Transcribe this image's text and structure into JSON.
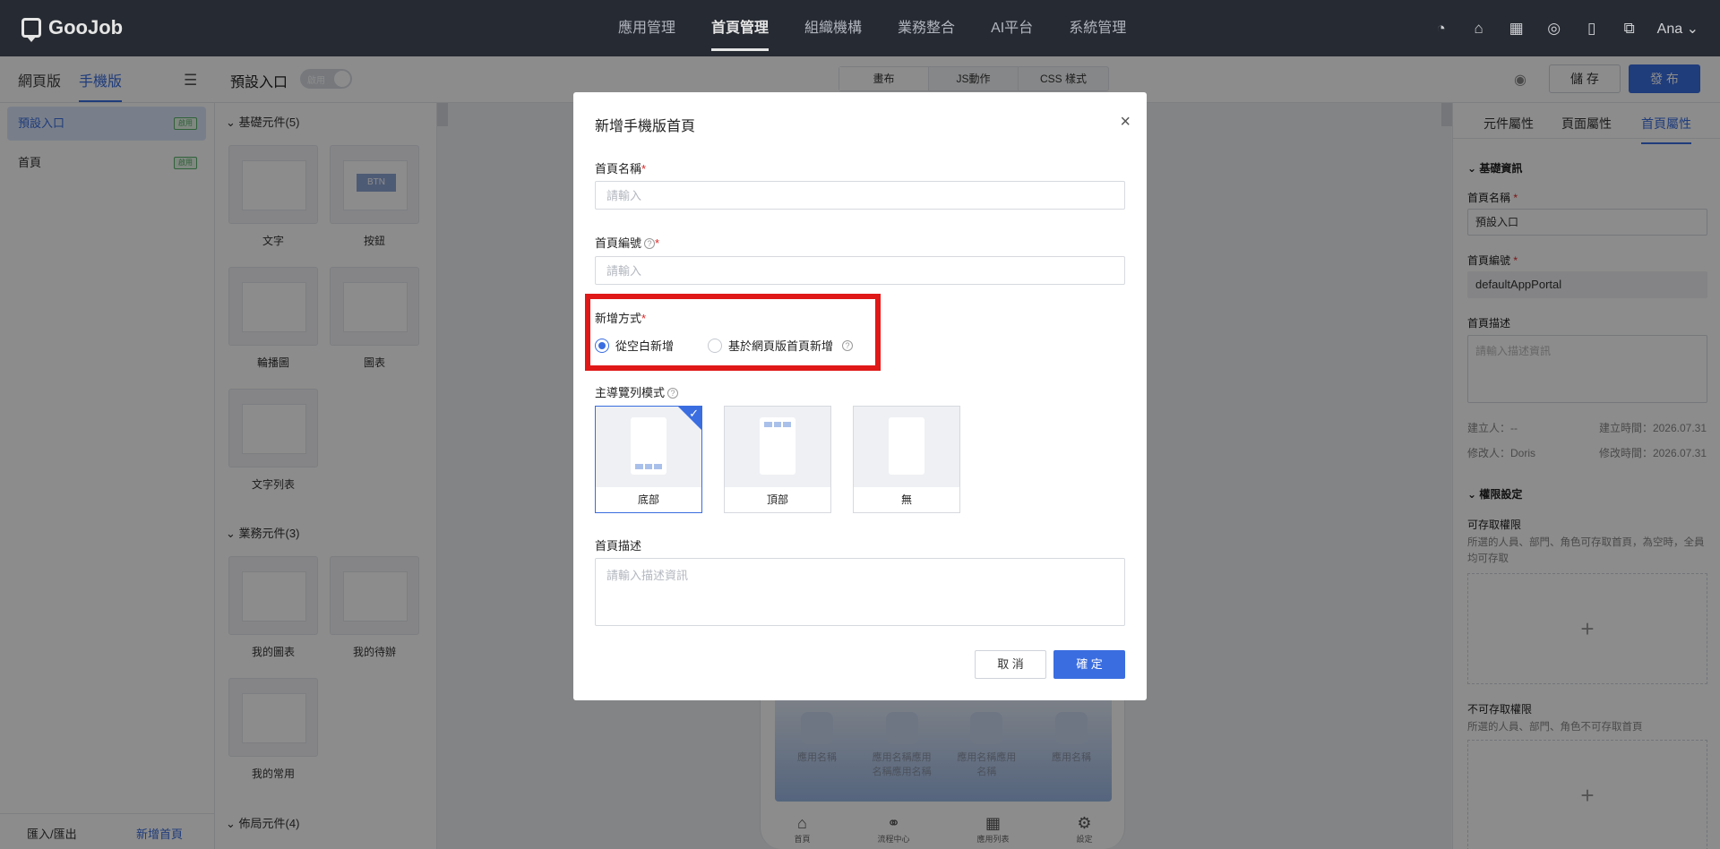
{
  "header": {
    "logo": "GooJob",
    "nav": [
      "應用管理",
      "首頁管理",
      "組織機構",
      "業務整合",
      "AI平台",
      "系統管理"
    ],
    "user": "Ana"
  },
  "toolbar": {
    "tab_web": "網頁版",
    "tab_mobile": "手機版",
    "entry_title": "預設入口",
    "toggle_label": "啟用",
    "segments": [
      "畫布",
      "JS動作",
      "CSS 樣式"
    ],
    "save_label": "儲 存",
    "publish_label": "發 布"
  },
  "sidebar": {
    "items": [
      {
        "label": "預設入口",
        "badge": "啟用"
      },
      {
        "label": "首頁",
        "badge": "啟用"
      }
    ],
    "import_export": "匯入/匯出",
    "add_home": "新增首頁"
  },
  "components": {
    "basic_title": "基礎元件(5)",
    "basic": [
      "文字",
      "按鈕",
      "輪播圖",
      "圖表",
      "文字列表"
    ],
    "business_title": "業務元件(3)",
    "business": [
      "我的圖表",
      "我的待辦",
      "我的常用"
    ],
    "layout_title": "佈局元件(4)",
    "btn_thumb": "BTN"
  },
  "phone": {
    "apps": [
      "應用名稱",
      "應用名稱應用名稱應用名稱",
      "應用名稱應用名稱",
      "應用名稱"
    ],
    "tabs": [
      "首頁",
      "流程中心",
      "應用列表",
      "設定"
    ]
  },
  "right_panel": {
    "tabs": [
      "元件屬性",
      "頁面屬性",
      "首頁屬性"
    ],
    "basic_info": "基礎資訊",
    "name_label": "首頁名稱",
    "name_value": "預設入口",
    "code_label": "首頁編號",
    "code_value": "defaultAppPortal",
    "desc_label": "首頁描述",
    "desc_placeholder": "請輸入描述資訊",
    "creator": "建立人：--",
    "created_time": "建立時間：2026.07.31",
    "modifier": "修改人：Doris",
    "modified_time": "修改時間：2026.07.31",
    "perm_title": "權限設定",
    "access_label": "可存取權限",
    "access_hint": "所選的人員、部門、角色可存取首頁，為空時，全員均可存取",
    "deny_label": "不可存取權限",
    "deny_hint": "所選的人員、部門、角色不可存取首頁",
    "plus": "+"
  },
  "modal": {
    "title": "新增手機版首頁",
    "name_label": "首頁名稱",
    "name_placeholder": "請輸入",
    "code_label": "首頁編號",
    "code_placeholder": "請輸入",
    "method_label": "新增方式",
    "method_options": [
      "從空白新增",
      "基於網頁版首頁新增"
    ],
    "method_selected": "從空白新增",
    "nav_label": "主導覽列模式",
    "nav_options": [
      "底部",
      "頂部",
      "無"
    ],
    "nav_selected": "底部",
    "desc_label": "首頁描述",
    "desc_placeholder": "請輸入描述資訊",
    "cancel_label": "取 消",
    "ok_label": "確 定"
  },
  "colors": {
    "accent": "#3a6de0",
    "header_bg": "#2b2f38",
    "highlight": "#e01818",
    "badge_green": "#58b36b"
  }
}
